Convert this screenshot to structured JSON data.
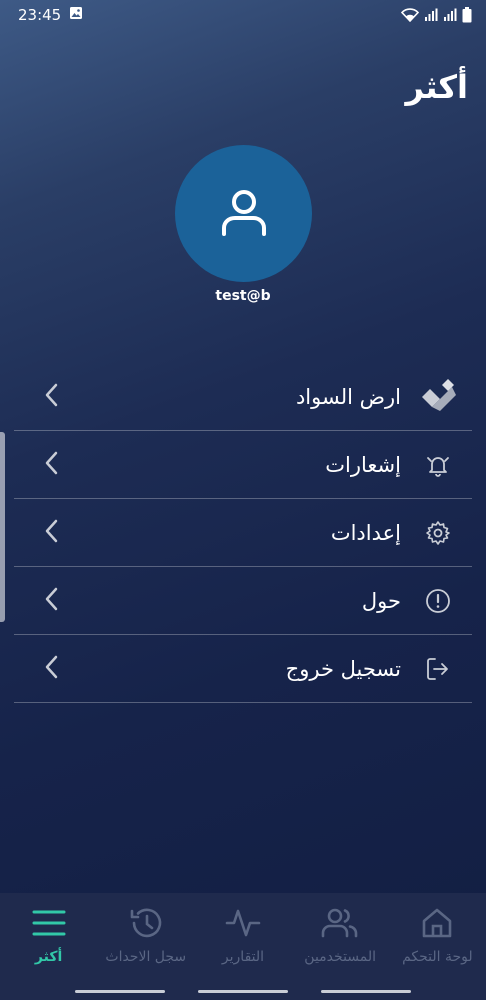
{
  "status_bar": {
    "time": "23:45"
  },
  "header": {
    "title": "أكثر"
  },
  "profile": {
    "email": "test@b"
  },
  "menu": [
    {
      "label": "ارض السواد",
      "icon": "brand-logo-icon"
    },
    {
      "label": "إشعارات",
      "icon": "bell-icon"
    },
    {
      "label": "إعدادات",
      "icon": "gear-icon"
    },
    {
      "label": "حول",
      "icon": "info-icon"
    },
    {
      "label": "تسجيل خروج",
      "icon": "logout-icon"
    }
  ],
  "bottom_nav": [
    {
      "label": "لوحة التحكم",
      "icon": "home-icon",
      "active": false
    },
    {
      "label": "المستخدمين",
      "icon": "users-icon",
      "active": false
    },
    {
      "label": "التقارير",
      "icon": "activity-icon",
      "active": false
    },
    {
      "label": "سجل الاحداث",
      "icon": "history-icon",
      "active": false
    },
    {
      "label": "أكثر",
      "icon": "menu-icon",
      "active": true
    }
  ],
  "colors": {
    "accent": "#32c8a8",
    "avatar_bg": "#1b6299",
    "nav_bg": "#1f2a4d",
    "nav_inactive": "#5a6684"
  }
}
